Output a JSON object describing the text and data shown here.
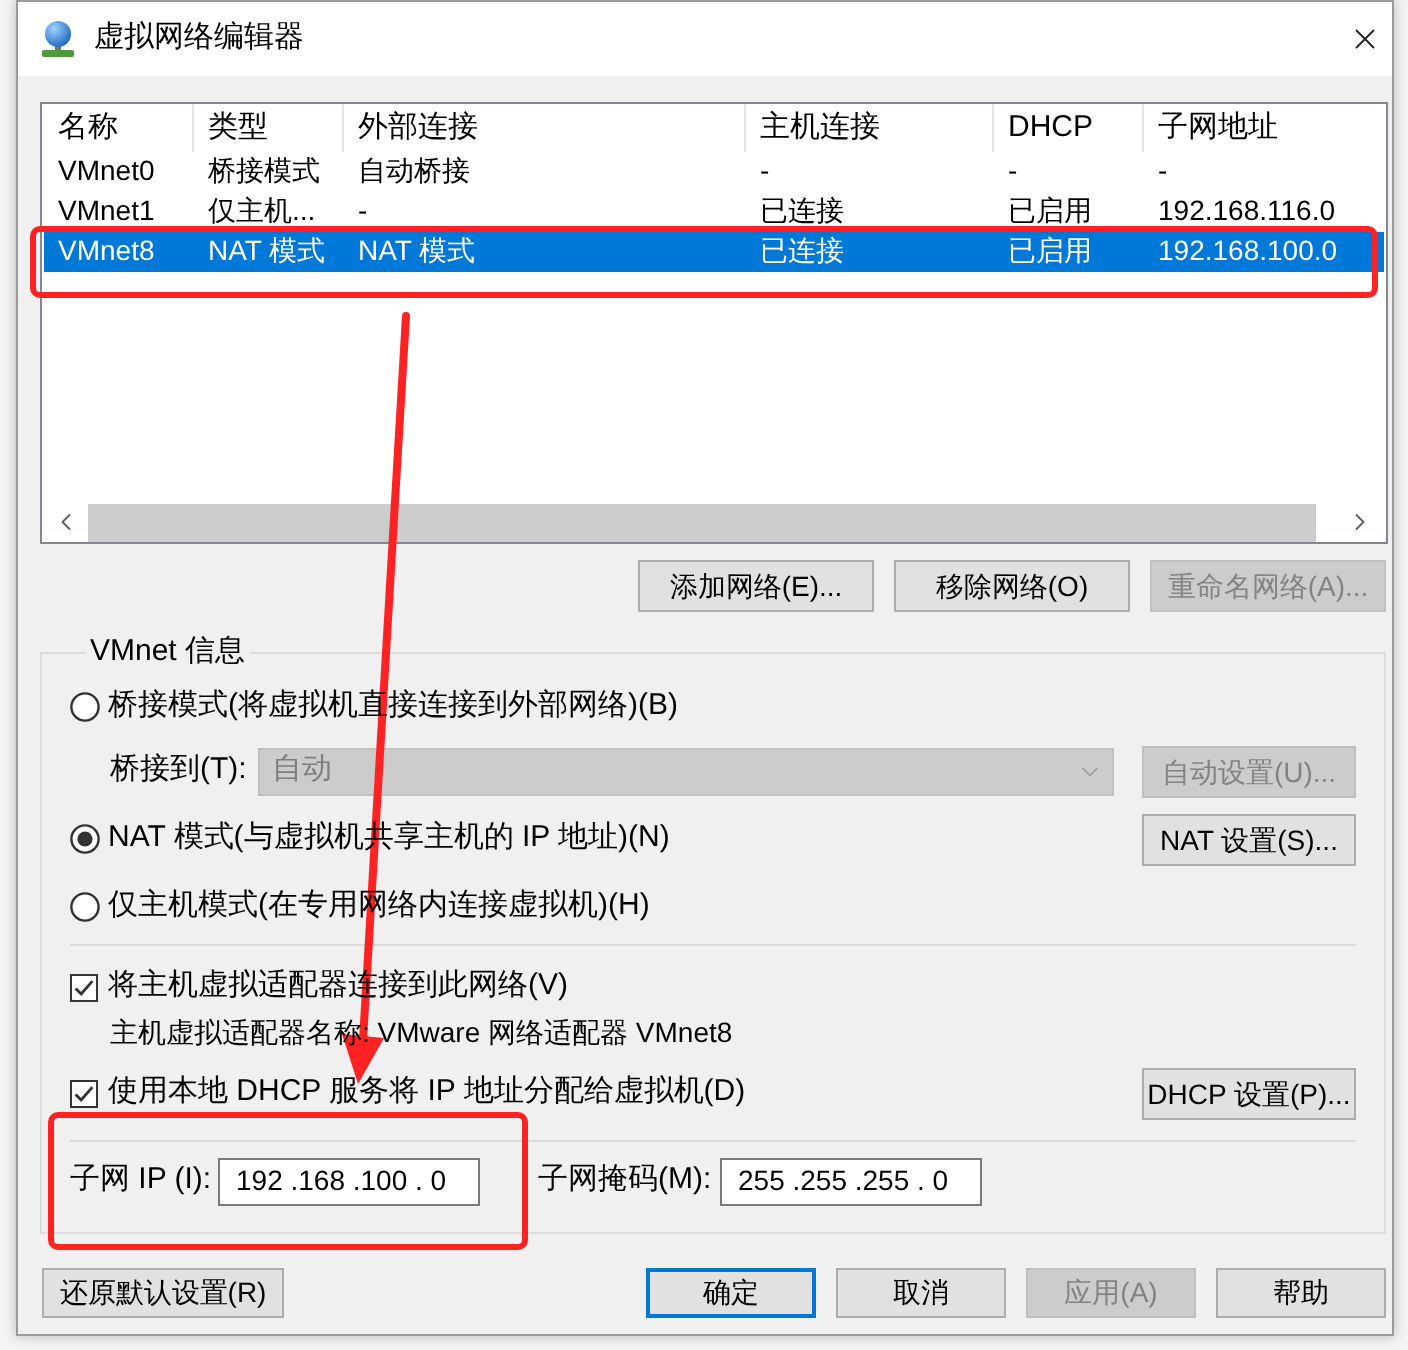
{
  "window": {
    "title": "虚拟网络编辑器"
  },
  "network_table": {
    "columns": [
      "名称",
      "类型",
      "外部连接",
      "主机连接",
      "DHCP",
      "子网地址"
    ],
    "rows": [
      {
        "cells": [
          "VMnet0",
          "桥接模式",
          "自动桥接",
          "-",
          "-",
          "-"
        ],
        "selected": false
      },
      {
        "cells": [
          "VMnet1",
          "仅主机...",
          "-",
          "已连接",
          "已启用",
          "192.168.116.0"
        ],
        "selected": false
      },
      {
        "cells": [
          "VMnet8",
          "NAT 模式",
          "NAT 模式",
          "已连接",
          "已启用",
          "192.168.100.0"
        ],
        "selected": true
      }
    ]
  },
  "table_buttons": [
    {
      "label": "添加网络(E)...",
      "disabled": false
    },
    {
      "label": "移除网络(O)",
      "disabled": false
    },
    {
      "label": "重命名网络(A)...",
      "disabled": true
    }
  ],
  "vmnet_info": {
    "title": "VMnet 信息",
    "modes": [
      {
        "label": "桥接模式(将虚拟机直接连接到外部网络)(B)",
        "selected": false,
        "bridge_to": {
          "label": "桥接到(T):",
          "value": "自动",
          "disabled": true,
          "button": {
            "label": "自动设置(U)...",
            "disabled": true
          }
        }
      },
      {
        "label": "NAT 模式(与虚拟机共享主机的 IP 地址)(N)",
        "selected": true,
        "button": {
          "label": "NAT 设置(S)...",
          "disabled": false
        }
      },
      {
        "label": "仅主机模式(在专用网络内连接虚拟机)(H)",
        "selected": false
      }
    ],
    "options": [
      {
        "label": "将主机虚拟适配器连接到此网络(V)",
        "checked": true,
        "note": "主机虚拟适配器名称: VMware 网络适配器 VMnet8"
      },
      {
        "label": "使用本地 DHCP 服务将 IP 地址分配给虚拟机(D)",
        "checked": true,
        "button": {
          "label": "DHCP 设置(P)...",
          "disabled": false
        }
      }
    ],
    "subnet_ip": {
      "label": "子网 IP (I):",
      "value": "192 .168 .100 . 0"
    },
    "subnet_mask": {
      "label": "子网掩码(M):",
      "value": "255 .255 .255 . 0"
    }
  },
  "restore_button": {
    "label": "还原默认设置(R)"
  },
  "dialog_buttons": [
    {
      "label": "确定",
      "default": true,
      "disabled": false
    },
    {
      "label": "取消",
      "default": false,
      "disabled": false
    },
    {
      "label": "应用(A)",
      "default": false,
      "disabled": true
    },
    {
      "label": "帮助",
      "default": false,
      "disabled": false
    }
  ]
}
